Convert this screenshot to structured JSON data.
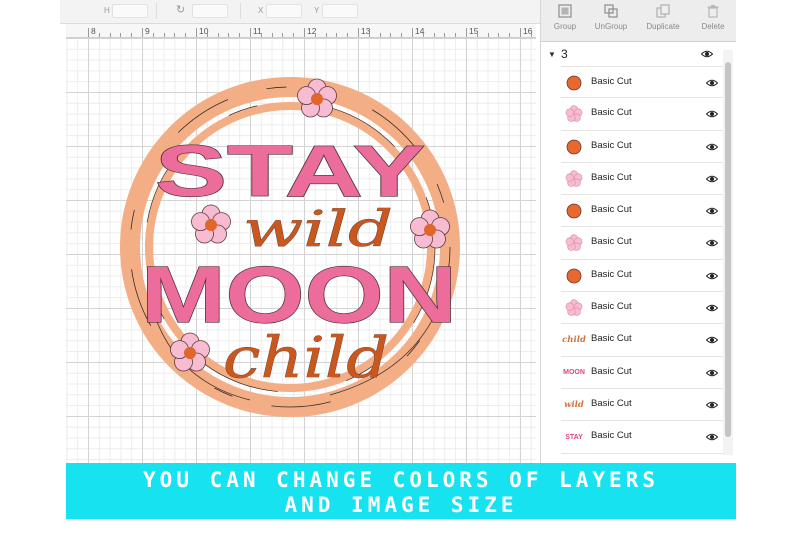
{
  "props": {
    "h": "H",
    "x": "X",
    "y": "Y"
  },
  "ruler": {
    "labels": [
      "8",
      "9",
      "10",
      "11",
      "12",
      "13",
      "14",
      "15",
      "16"
    ]
  },
  "design": {
    "word_stay": "STAY",
    "word_wild": "wild",
    "word_moon": "MOON",
    "word_child": "child",
    "colors": {
      "pink": "#ec6c9c",
      "peach": "#f3ae86",
      "orange": "#e2652a",
      "light_pink": "#f7bcd2",
      "rust": "#c8581e"
    }
  },
  "toolbar": {
    "group": "Group",
    "ungroup": "UnGroup",
    "duplicate": "Duplicate",
    "delete": "Delete"
  },
  "layers_panel": {
    "group_name": "3",
    "layers": [
      {
        "label": "Basic Cut",
        "thumb": "orange-dot",
        "color": "#e8692f"
      },
      {
        "label": "Basic Cut",
        "thumb": "pink-flower",
        "color": "#f7bcd2"
      },
      {
        "label": "Basic Cut",
        "thumb": "orange-dot",
        "color": "#e8692f"
      },
      {
        "label": "Basic Cut",
        "thumb": "pink-flower",
        "color": "#f7bcd2"
      },
      {
        "label": "Basic Cut",
        "thumb": "orange-dot",
        "color": "#e8692f"
      },
      {
        "label": "Basic Cut",
        "thumb": "pink-flower",
        "color": "#f7bcd2"
      },
      {
        "label": "Basic Cut",
        "thumb": "orange-dot",
        "color": "#e8692f"
      },
      {
        "label": "Basic Cut",
        "thumb": "pink-flower",
        "color": "#f7bcd2"
      },
      {
        "label": "Basic Cut",
        "thumb": "text",
        "thumb_text": "child",
        "color": "#d0733f"
      },
      {
        "label": "Basic Cut",
        "thumb": "text",
        "thumb_text": "MOON",
        "color": "#e0457f"
      },
      {
        "label": "Basic Cut",
        "thumb": "text",
        "thumb_text": "wild",
        "color": "#d0733f"
      },
      {
        "label": "Basic Cut",
        "thumb": "text",
        "thumb_text": "STAY",
        "color": "#e0457f"
      }
    ]
  },
  "banner": {
    "line1": "YOU CAN CHANGE COLORS OF LAYERS",
    "line2": "AND IMAGE SIZE",
    "color": "#17e3f0"
  }
}
